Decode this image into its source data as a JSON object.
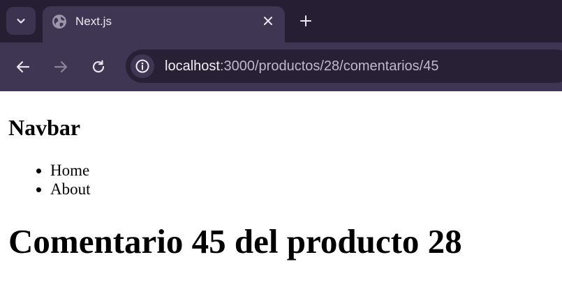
{
  "browser": {
    "tab": {
      "title": "Next.js"
    },
    "address_bar": {
      "host": "localhost",
      "path": ":3000/productos/28/comentarios/45"
    }
  },
  "page": {
    "navbar_heading": "Navbar",
    "nav_links": [
      {
        "label": "Home"
      },
      {
        "label": "About"
      }
    ],
    "main_heading": "Comentario 45 del producto 28"
  },
  "colors": {
    "tabstrip_bg": "#261f34",
    "toolbar_bg": "#3f3653",
    "omnibox_bg": "#282136"
  }
}
